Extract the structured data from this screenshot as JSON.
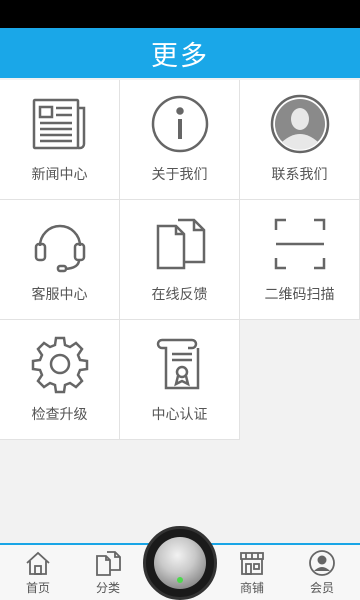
{
  "header": {
    "title": "更多"
  },
  "grid": {
    "items": [
      {
        "label": "新闻中心",
        "icon": "newspaper-icon"
      },
      {
        "label": "关于我们",
        "icon": "info-icon"
      },
      {
        "label": "联系我们",
        "icon": "contact-person-icon"
      },
      {
        "label": "客服中心",
        "icon": "headset-icon"
      },
      {
        "label": "在线反馈",
        "icon": "documents-icon"
      },
      {
        "label": "二维码扫描",
        "icon": "scan-frame-icon"
      },
      {
        "label": "检查升级",
        "icon": "gear-icon"
      },
      {
        "label": "中心认证",
        "icon": "certificate-scroll-icon"
      }
    ]
  },
  "tabbar": {
    "home": "首页",
    "category": "分类",
    "shop": "商铺",
    "member": "会员"
  },
  "colors": {
    "accent": "#1aa7e8",
    "icon_stroke": "#666666"
  }
}
